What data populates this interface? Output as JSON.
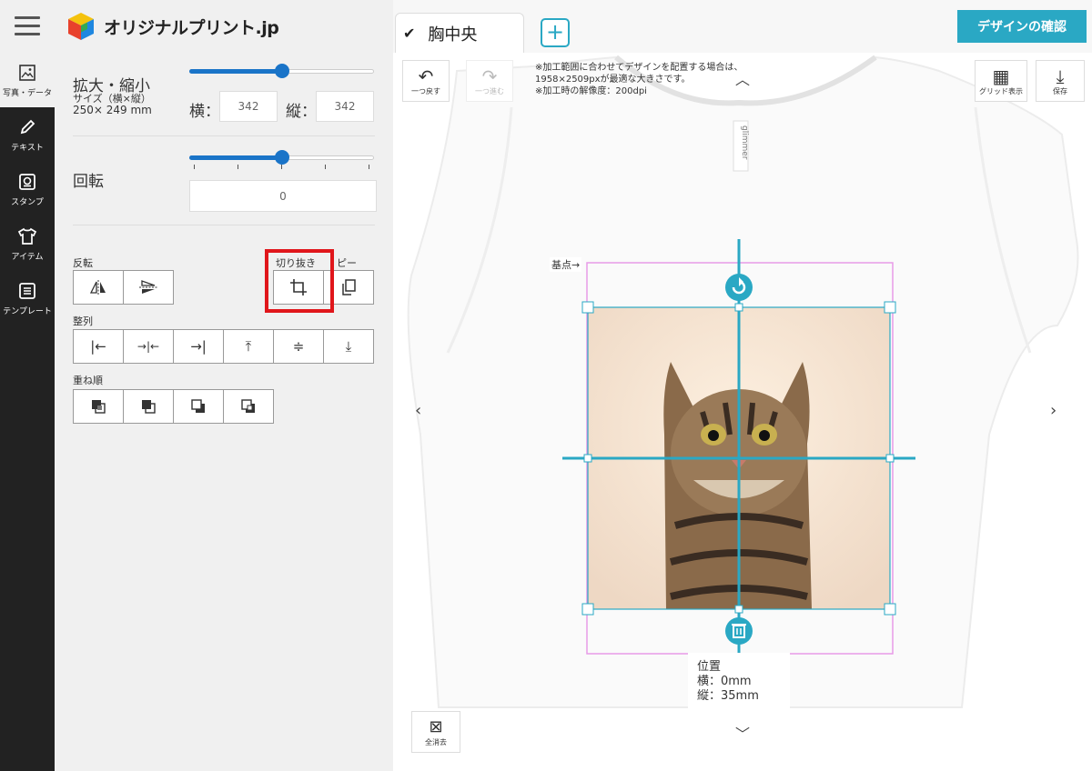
{
  "header": {
    "logo_text": "オリジナルプリント.jp"
  },
  "rail": {
    "items": [
      {
        "label": "写真・データ",
        "icon": "image-icon"
      },
      {
        "label": "テキスト",
        "icon": "pencil-icon"
      },
      {
        "label": "スタンプ",
        "icon": "stamp-icon"
      },
      {
        "label": "アイテム",
        "icon": "tshirt-icon"
      },
      {
        "label": "テンプレート",
        "icon": "template-icon"
      }
    ]
  },
  "panel": {
    "scale_label": "拡大・縮小",
    "size_caption": "サイズ（横×縦）",
    "size_value": "250× 249 mm",
    "width_label": "横：",
    "width_value": "342",
    "height_label": "縦：",
    "height_value": "342",
    "rotate_label": "回転",
    "rotate_value": "0",
    "flip_label": "反転",
    "crop_label": "切り抜き",
    "copy_label": "ピー",
    "align_label": "整列",
    "order_label": "重ね順",
    "scale_slider": 0.5,
    "rotate_slider": 0.5
  },
  "tabs": {
    "active_label": "胸中央",
    "add_label": "+"
  },
  "actions": {
    "confirm_label": "デザインの確認"
  },
  "toolbar": {
    "undo_label": "一つ戻す",
    "redo_label": "一つ進む",
    "grid_label": "グリッド表示",
    "save_label": "保存",
    "clear_label": "全消去"
  },
  "info": {
    "line1": "※加工範囲に合わせてデザインを配置する場合は、",
    "line2": "1958×2509pxが最適な大きさです。",
    "line3": "※加工時の解像度：200dpi"
  },
  "canvas": {
    "base_label": "基点→",
    "position_title": "位置",
    "position_x": "横：0mm",
    "position_y": "縦：35mm",
    "brand_tag": "glimmer"
  },
  "colors": {
    "accent": "#2aa8c4",
    "slider": "#1a74c8",
    "highlight": "#e0161b",
    "print_area": "#e89be8"
  }
}
